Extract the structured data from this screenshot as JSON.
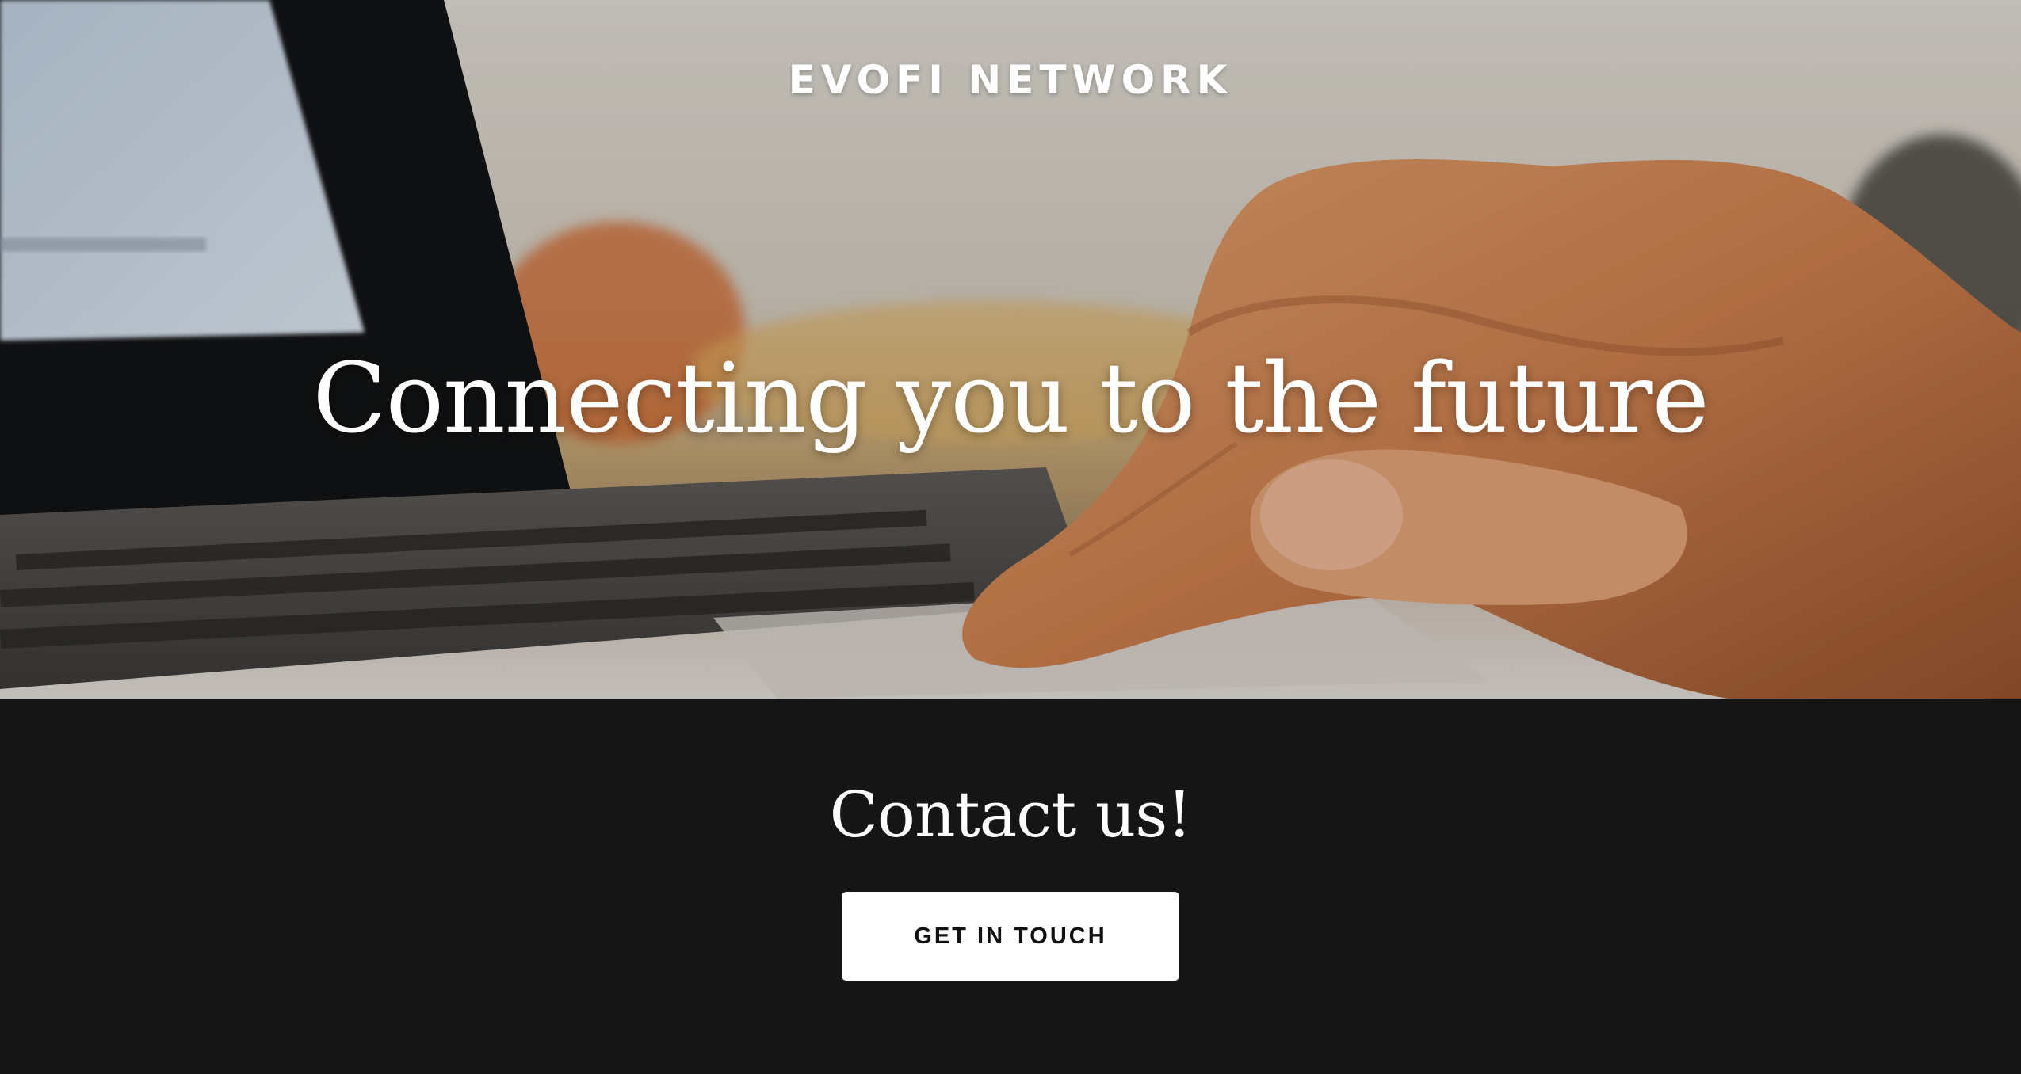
{
  "site": {
    "brand": "EVOFI NETWORK"
  },
  "hero": {
    "headline": "Connecting you to the future"
  },
  "contact": {
    "title": "Contact us!",
    "button_label": "GET IN TOUCH"
  },
  "colors": {
    "footer_bg": "#151515",
    "text_light": "#ffffff",
    "button_bg": "#ffffff",
    "button_text": "#111111"
  }
}
